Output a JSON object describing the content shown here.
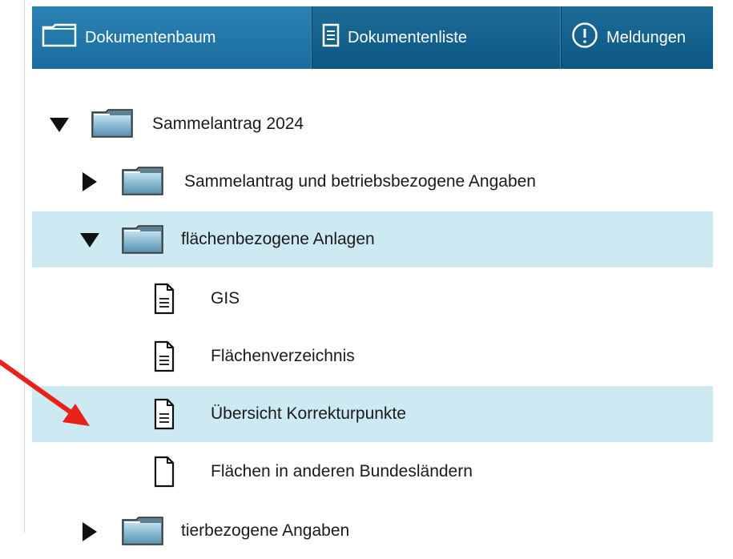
{
  "tabs": [
    {
      "label": "Dokumentenbaum",
      "icon": "folder-icon"
    },
    {
      "label": "Dokumentenliste",
      "icon": "list-document-icon"
    },
    {
      "label": "Meldungen",
      "icon": "exclamation-circle-icon"
    }
  ],
  "tree": {
    "root": {
      "label": "Sammelantrag 2024",
      "expanded": true
    },
    "items": [
      {
        "label": "Sammelantrag und betriebsbezogene Angaben",
        "type": "folder",
        "expanded": false
      },
      {
        "label": "flächenbezogene Anlagen",
        "type": "folder",
        "expanded": true
      },
      {
        "label": "GIS",
        "type": "document"
      },
      {
        "label": "Flächenverzeichnis",
        "type": "document"
      },
      {
        "label": "Übersicht Korrekturpunkte",
        "type": "document",
        "selected": true
      },
      {
        "label": "Flächen in anderen Bundesländern",
        "type": "document-empty"
      },
      {
        "label": "tierbezogene Angaben",
        "type": "folder",
        "expanded": false
      }
    ]
  },
  "colors": {
    "tabbar": "#0d5784",
    "selected_row": "#cde9f2",
    "annotation_arrow": "#e8221b"
  }
}
